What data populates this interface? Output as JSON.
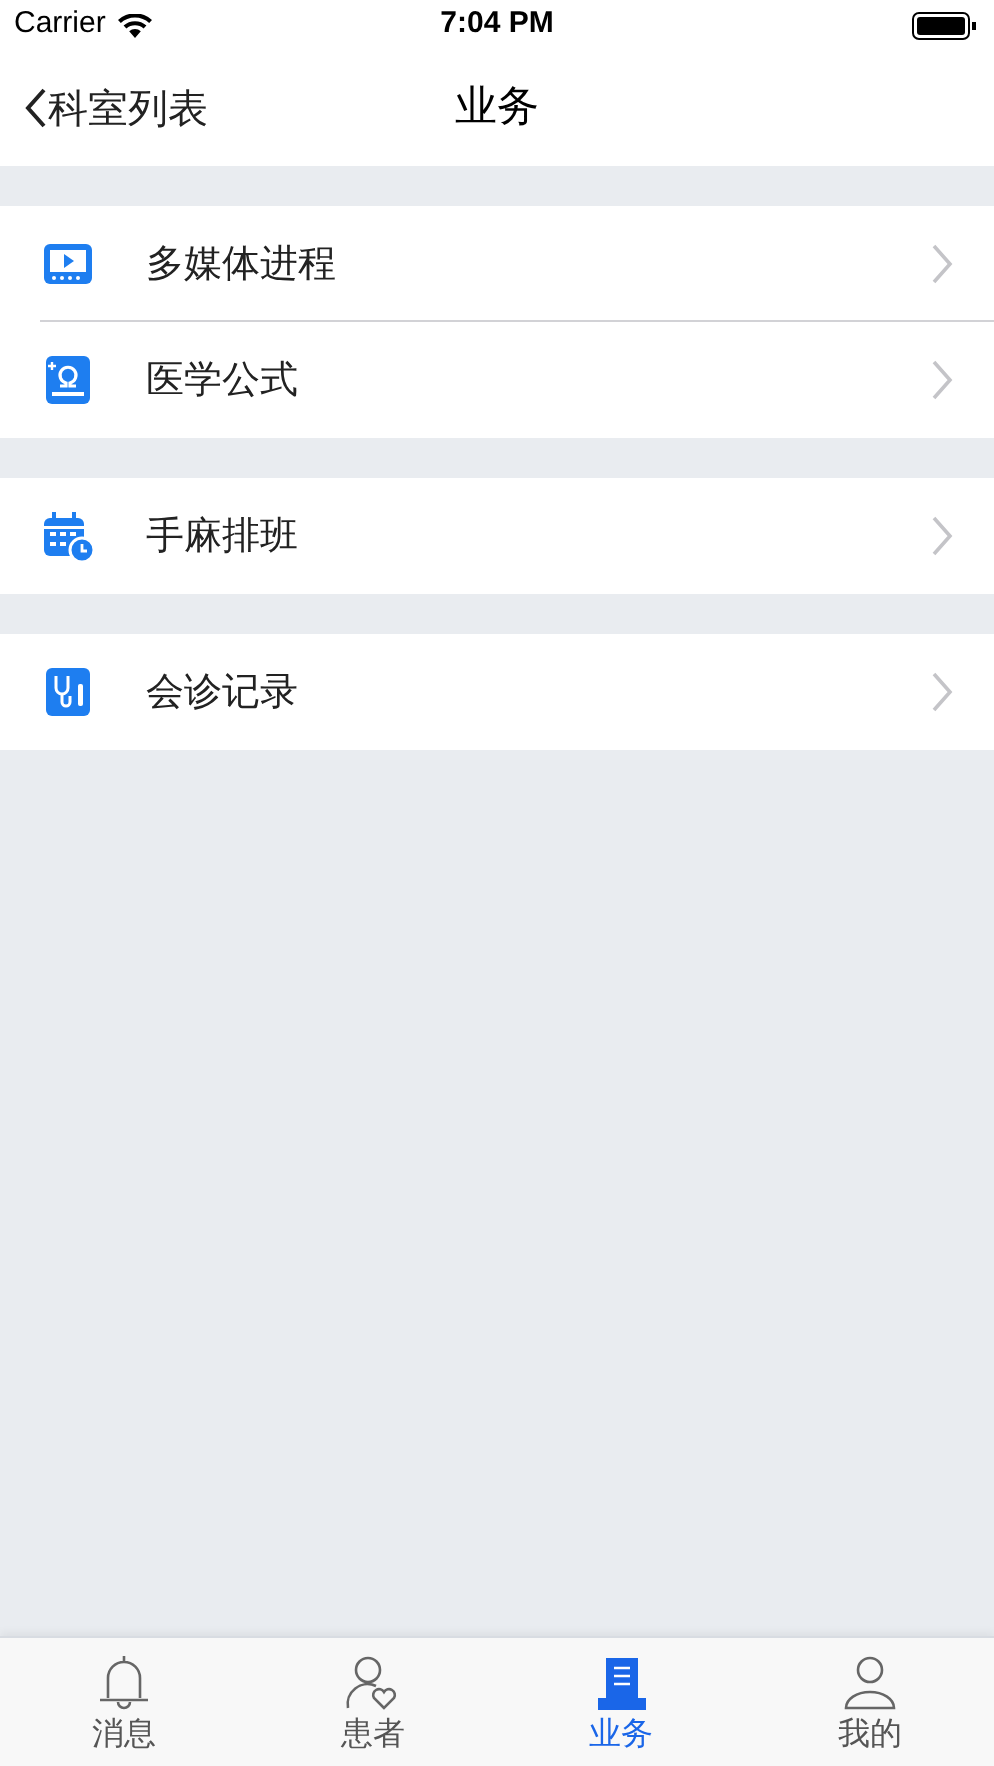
{
  "status_bar": {
    "carrier": "Carrier",
    "time": "7:04 PM"
  },
  "nav": {
    "back": "科室列表",
    "title": "业务"
  },
  "groups": [
    {
      "items": [
        {
          "label": "多媒体进程",
          "kind": "video"
        },
        {
          "label": "医学公式",
          "kind": "formula"
        }
      ]
    },
    {
      "items": [
        {
          "label": "手麻排班",
          "kind": "calendar"
        }
      ]
    },
    {
      "items": [
        {
          "label": "会诊记录",
          "kind": "stethoscope"
        }
      ]
    }
  ],
  "tabs": [
    {
      "label": "消息",
      "kind": "bell",
      "selected": false
    },
    {
      "label": "患者",
      "kind": "patient",
      "selected": false
    },
    {
      "label": "业务",
      "kind": "document",
      "selected": true
    },
    {
      "label": "我的",
      "kind": "person",
      "selected": false
    }
  ]
}
